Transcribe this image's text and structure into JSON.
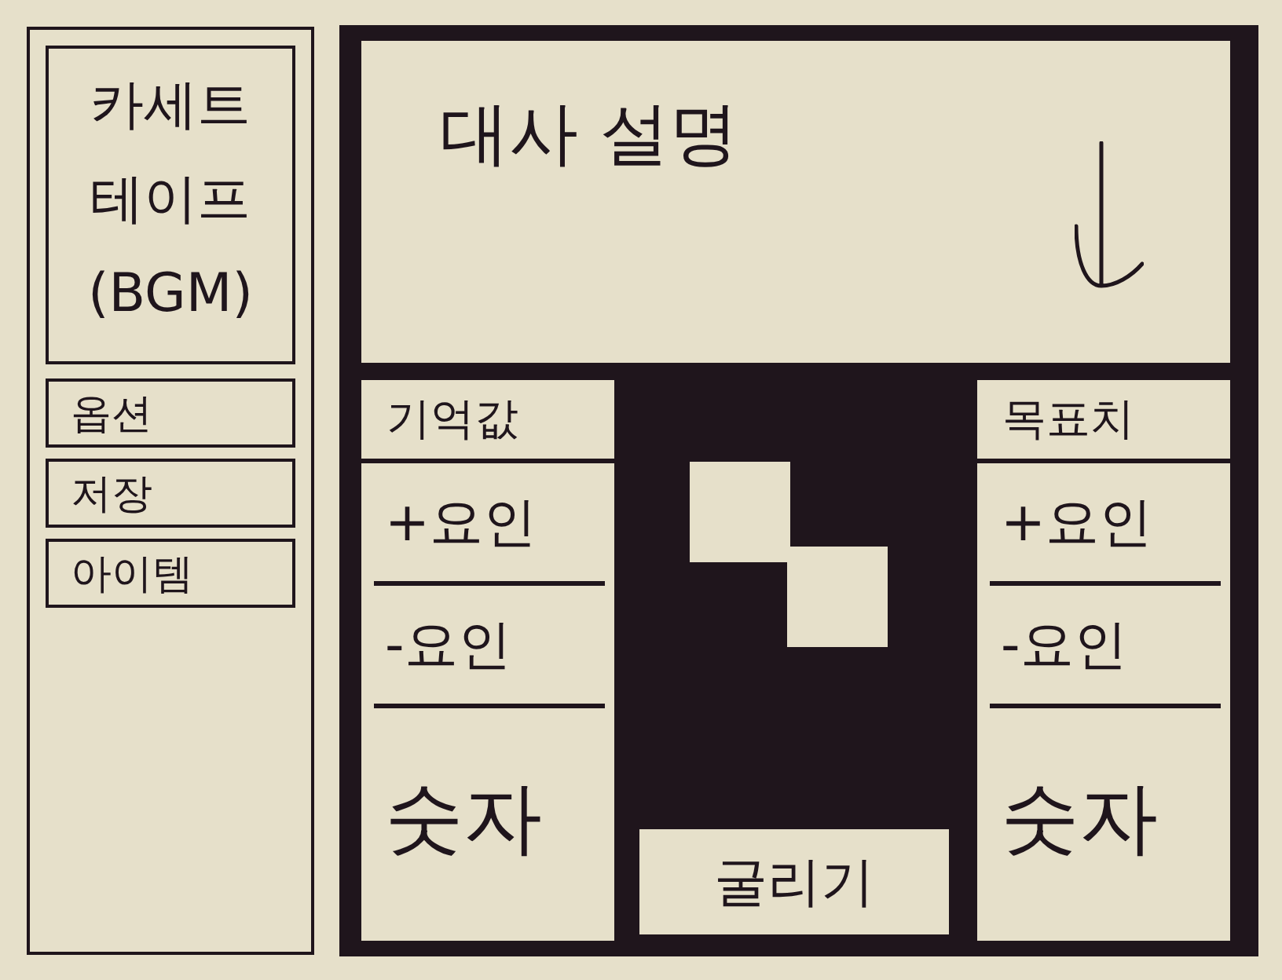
{
  "sidebar": {
    "bgm_panel": {
      "title": "카세트 테이프 (BGM)"
    },
    "menu": [
      {
        "label": "옵션"
      },
      {
        "label": "저장"
      },
      {
        "label": "아이템"
      }
    ]
  },
  "dialogue": {
    "text": "대사 설명"
  },
  "columns": [
    {
      "title": "기억값",
      "rows": [
        {
          "kind": "factor",
          "label": "+요인"
        },
        {
          "kind": "factor",
          "label": "-요인"
        },
        {
          "kind": "number",
          "label": "숫자"
        }
      ]
    },
    {
      "title": "목표치",
      "rows": [
        {
          "kind": "factor",
          "label": "+요인"
        },
        {
          "kind": "factor",
          "label": "-요인"
        },
        {
          "kind": "number",
          "label": "숫자"
        }
      ]
    }
  ],
  "roll_button": {
    "label": "굴리기"
  }
}
